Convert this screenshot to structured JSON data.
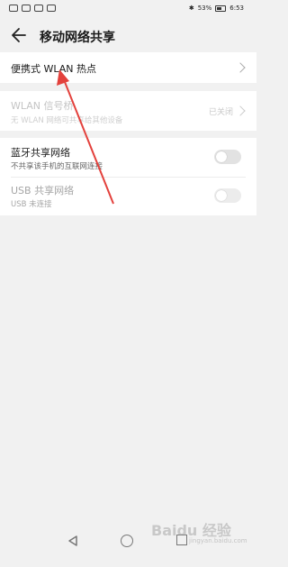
{
  "status_bar": {
    "battery_percent": "53%",
    "time": "6:53"
  },
  "header": {
    "title": "移动网络共享"
  },
  "portable_hotspot": {
    "label": "便携式 WLAN 热点"
  },
  "wlan_signal": {
    "title": "WLAN 信号桥",
    "subtitle": "无 WLAN 网络可共享给其他设备",
    "status": "已关闭"
  },
  "bluetooth_sharing": {
    "title": "蓝牙共享网络",
    "subtitle": "不共享该手机的互联网连接",
    "enabled": false
  },
  "usb_sharing": {
    "title": "USB 共享网络",
    "subtitle": "USB 未连接",
    "enabled": false
  },
  "watermark": {
    "text": "Baidu 经验",
    "sub": "jingyan.baidu.com"
  },
  "colors": {
    "arrow": "#e3413c",
    "background": "#f1f1f1",
    "card": "#ffffff"
  }
}
